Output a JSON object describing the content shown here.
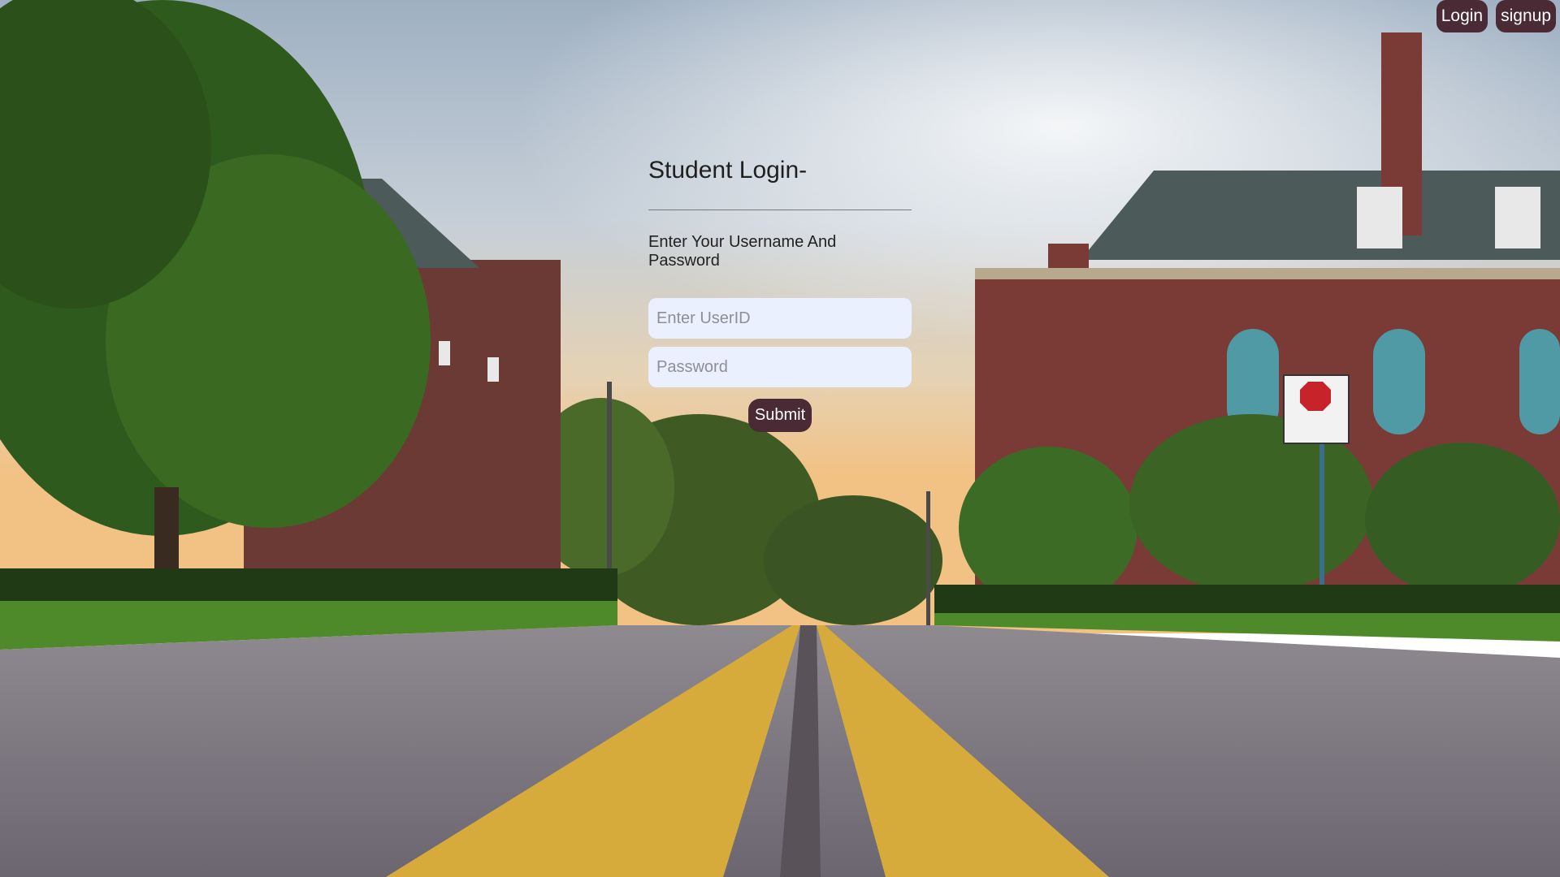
{
  "nav": {
    "login_label": "Login",
    "signup_label": "signup"
  },
  "login": {
    "title": "Student Login-",
    "subtitle": "Enter Your Username And Password",
    "userid_placeholder": "Enter UserID",
    "userid_value": "",
    "password_placeholder": "Password",
    "password_value": "",
    "submit_label": "Submit"
  },
  "colors": {
    "button_bg": "#4a2a35",
    "input_bg": "#eaf0fe"
  }
}
